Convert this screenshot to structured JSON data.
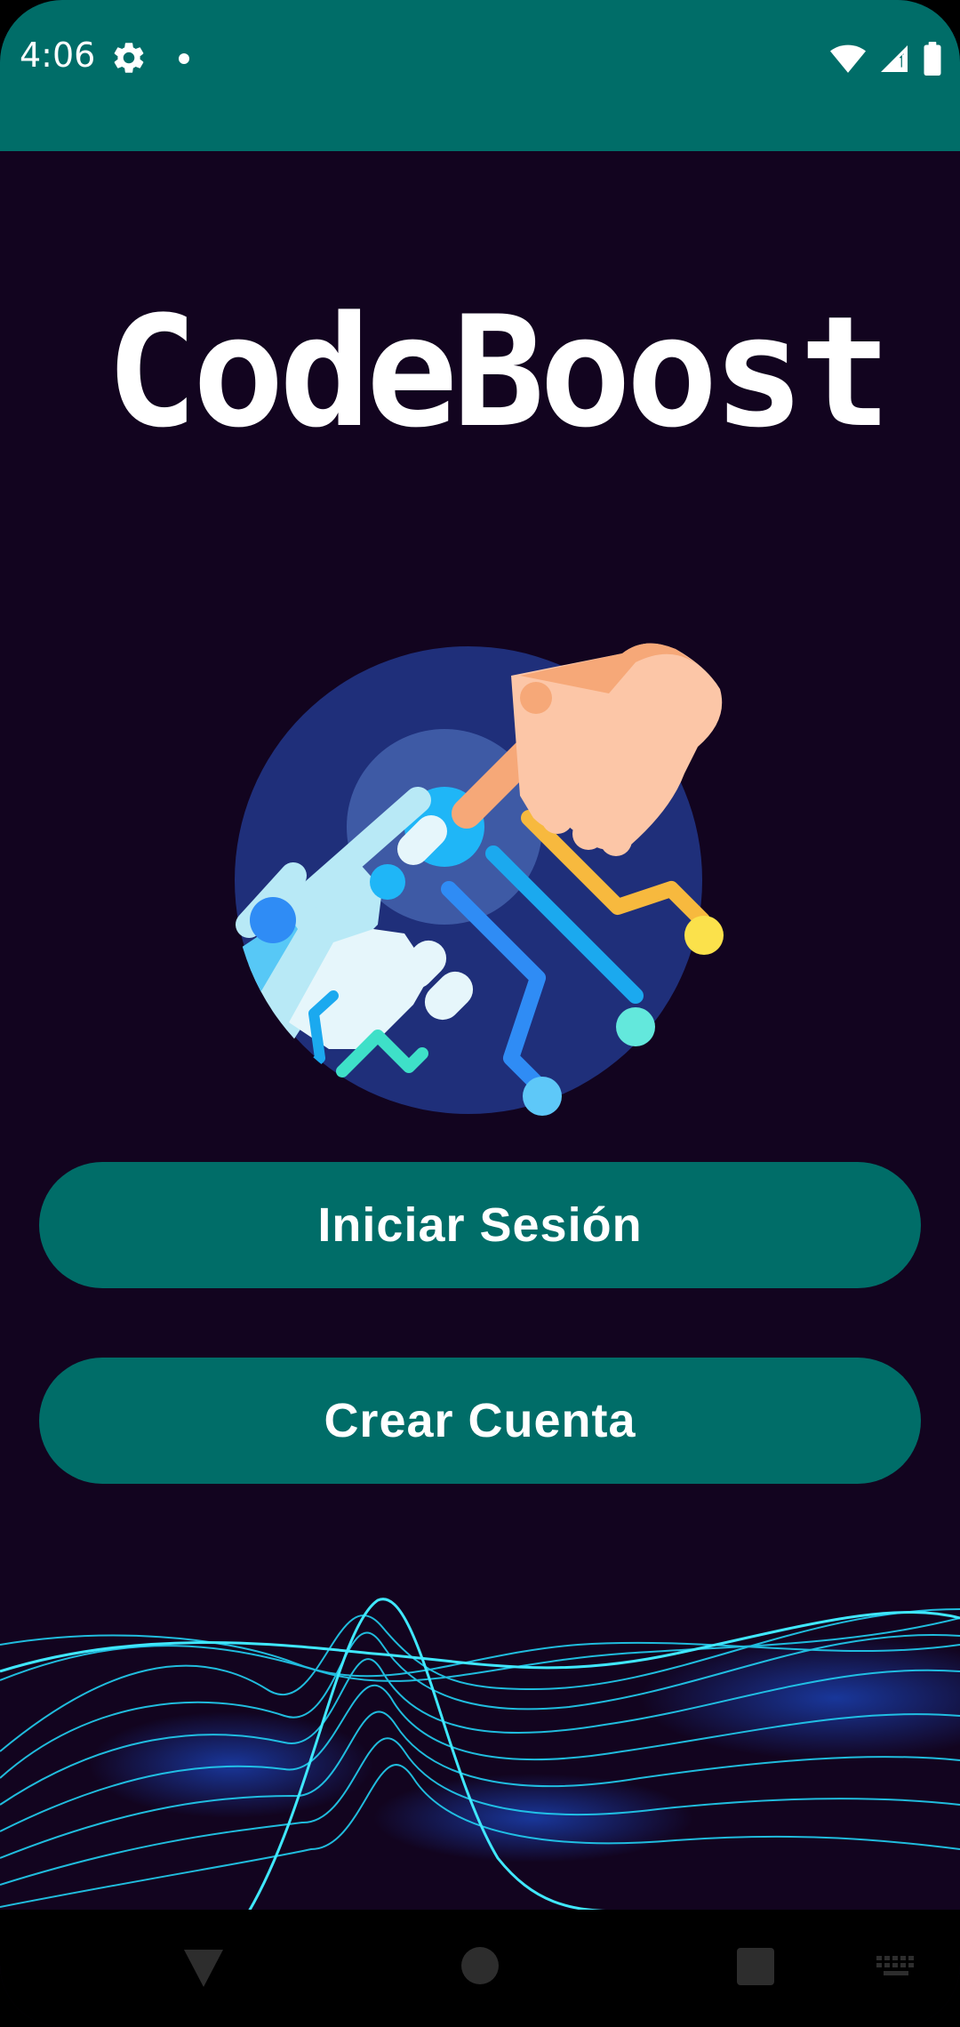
{
  "status_bar": {
    "time": "4:06",
    "icons": [
      "settings-icon",
      "notification-dot-icon",
      "wifi-icon",
      "cellular-signal-icon",
      "battery-icon"
    ],
    "background_color": "#006d68"
  },
  "app": {
    "title": "CodeBoost",
    "illustration": "hand-touching-circuit-illustration",
    "background_color": "#12041f"
  },
  "buttons": {
    "login_label": "Iniciar Sesión",
    "register_label": "Crear Cuenta",
    "color": "#006d68"
  },
  "navigation_bar": {
    "icons": [
      "back-icon",
      "home-icon",
      "recents-icon",
      "keyboard-icon"
    ]
  }
}
